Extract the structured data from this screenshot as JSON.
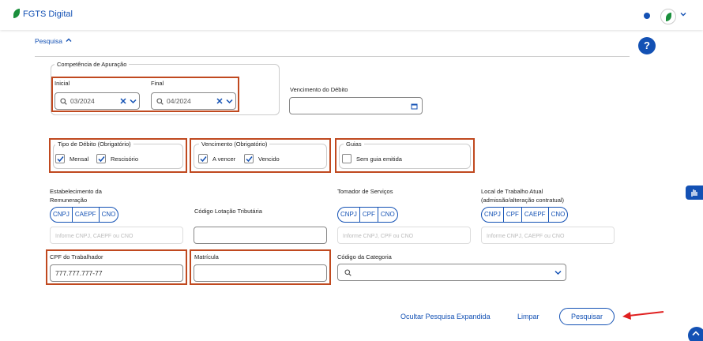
{
  "header": {
    "app_title": "FGTS Digital"
  },
  "search": {
    "section_label": "Pesquisa",
    "help_label": "?"
  },
  "competencia": {
    "legend": "Competência de Apuração",
    "inicial_label": "Inicial",
    "inicial_value": "03/2024",
    "final_label": "Final",
    "final_value": "04/2024"
  },
  "vencimento_debito": {
    "label": "Vencimento do Débito"
  },
  "tipo_debito": {
    "legend": "Tipo de Débito (Obrigatório)",
    "options": [
      "Mensal",
      "Rescisório"
    ]
  },
  "vencimento": {
    "legend": "Vencimento (Obrigatório)",
    "options": [
      "A vencer",
      "Vencido"
    ]
  },
  "guias": {
    "legend": "Guias",
    "option": "Sem guia emitida"
  },
  "estabelecimento": {
    "label_line1": "Estabelecimento da",
    "label_line2": "Remuneração",
    "types": [
      "CNPJ",
      "CAEPF",
      "CNO"
    ],
    "placeholder": "Informe CNPJ, CAEPF ou CNO"
  },
  "lotacao": {
    "label": "Código Lotação Tributária"
  },
  "tomador": {
    "label": "Tomador de Serviços",
    "types": [
      "CNPJ",
      "CPF",
      "CNO"
    ],
    "placeholder": "Informe CNPJ, CPF ou CNO"
  },
  "local_trabalho": {
    "label_line1": "Local de Trabalho Atual",
    "label_line2": "(admissão/alteração contratual)",
    "types": [
      "CNPJ",
      "CPF",
      "CAEPF",
      "CNO"
    ],
    "placeholder": "Informe CNPJ, CAEPF ou CNO"
  },
  "cpf_trabalhador": {
    "label": "CPF do Trabalhador",
    "value": "777.777.777-77"
  },
  "matricula": {
    "label": "Matrícula"
  },
  "categoria": {
    "label": "Código da Categoria"
  },
  "actions": {
    "ocultar": "Ocultar Pesquisa Expandida",
    "limpar": "Limpar",
    "pesquisar": "Pesquisar"
  },
  "colors": {
    "primary": "#1351b4",
    "highlight": "#c0491f",
    "arrow": "#e02020"
  }
}
